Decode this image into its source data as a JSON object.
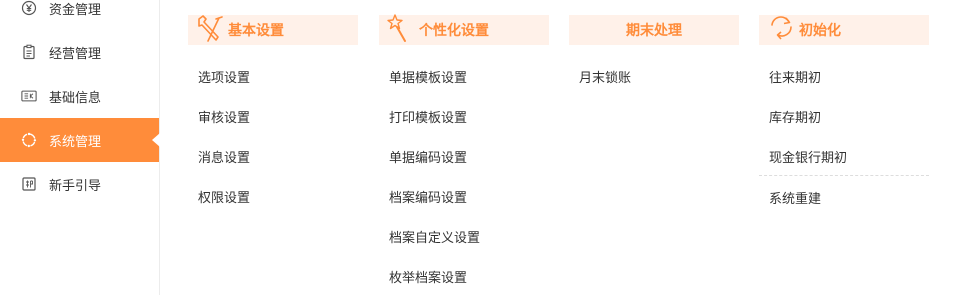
{
  "sidebar": {
    "items": [
      {
        "label": "资金管理",
        "icon": "yen-icon"
      },
      {
        "label": "经营管理",
        "icon": "clipboard-icon"
      },
      {
        "label": "基础信息",
        "icon": "id-card-icon"
      },
      {
        "label": "系统管理",
        "icon": "settings-icon",
        "active": true
      },
      {
        "label": "新手引导",
        "icon": "guide-icon"
      }
    ]
  },
  "columns": [
    {
      "title": "基本设置",
      "icon": "wrench-icon",
      "items": [
        "选项设置",
        "审核设置",
        "消息设置",
        "权限设置"
      ]
    },
    {
      "title": "个性化设置",
      "icon": "star-wand-icon",
      "items": [
        "单据模板设置",
        "打印模板设置",
        "单据编码设置",
        "档案编码设置",
        "档案自定义设置",
        "枚举档案设置"
      ]
    },
    {
      "title": "期末处理",
      "icon": "",
      "items": [
        "月末锁账"
      ]
    },
    {
      "title": "初始化",
      "icon": "refresh-icon",
      "items": [
        "往来期初",
        "库存期初",
        "现金银行期初",
        "系统重建"
      ]
    }
  ],
  "colors": {
    "accent": "#ff8c3a",
    "header_bg": "#fff1e9"
  }
}
